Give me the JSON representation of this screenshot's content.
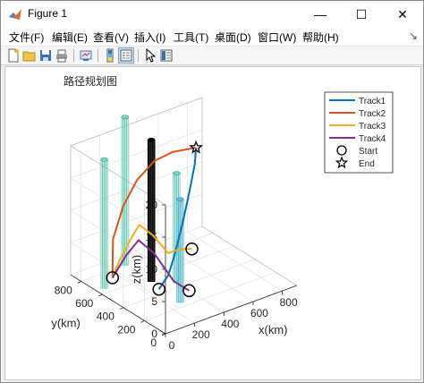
{
  "window": {
    "title": "Figure 1",
    "minimize": "—",
    "maximize": "☐",
    "close": "✕"
  },
  "menu": [
    {
      "label": "文件(F)"
    },
    {
      "label": "编辑(E)"
    },
    {
      "label": "查看(V)"
    },
    {
      "label": "插入(I)"
    },
    {
      "label": "工具(T)"
    },
    {
      "label": "桌面(D)"
    },
    {
      "label": "窗口(W)"
    },
    {
      "label": "帮助(H)"
    }
  ],
  "menu_pin": "↘",
  "toolbar_icons": [
    "new-figure-icon",
    "open-file-icon",
    "save-icon",
    "print-icon",
    "link-plot-icon",
    "toggle-colorbar-icon",
    "insert-legend-icon",
    "pointer-icon",
    "property-inspector-icon"
  ],
  "chart_data": {
    "type": "line3d",
    "title": "路径规划图",
    "xlabel": "x(km)",
    "ylabel": "y(km)",
    "zlabel": "z(km)",
    "xlim": [
      0,
      900
    ],
    "ylim": [
      0,
      900
    ],
    "zlim": [
      0,
      20
    ],
    "xticks": [
      "0",
      "200",
      "400",
      "600",
      "800"
    ],
    "yticks": [
      "0",
      "200",
      "400",
      "600",
      "800"
    ],
    "zticks": [
      "0",
      "5",
      "10",
      "15",
      "20"
    ],
    "grid": true,
    "legend_position": "top-right",
    "legend": [
      {
        "label": "Track1",
        "kind": "line",
        "color": "#0072BD"
      },
      {
        "label": "Track2",
        "kind": "line",
        "color": "#D95319"
      },
      {
        "label": "Track3",
        "kind": "line",
        "color": "#EDB120"
      },
      {
        "label": "Track4",
        "kind": "line",
        "color": "#7E2F8E"
      },
      {
        "label": "Start",
        "kind": "circle",
        "color": "#000000"
      },
      {
        "label": "End",
        "kind": "star",
        "color": "#000000"
      }
    ],
    "obstacles": [
      {
        "x": 50,
        "y": 650,
        "height": 20,
        "color": "#79dbba"
      },
      {
        "x": 300,
        "y": 800,
        "height": 23,
        "color": "#79dbba"
      },
      {
        "x": 300,
        "y": 550,
        "height": 22,
        "color": "#000000"
      },
      {
        "x": 400,
        "y": 450,
        "height": 17,
        "color": "#70d4c6"
      },
      {
        "x": 280,
        "y": 250,
        "height": 16,
        "color": "#55bce8"
      }
    ],
    "start_points": [
      [
        70,
        600,
        2
      ],
      [
        280,
        450,
        0
      ],
      [
        400,
        330,
        0
      ],
      [
        700,
        720,
        0
      ]
    ],
    "end_point": [
      750,
      750,
      15
    ],
    "series": [
      {
        "name": "Track1",
        "color": "#0072BD",
        "points": [
          [
            280,
            450,
            0
          ],
          [
            330,
            430,
            2
          ],
          [
            400,
            470,
            4
          ],
          [
            520,
            560,
            7
          ],
          [
            640,
            660,
            10
          ],
          [
            720,
            720,
            13
          ],
          [
            750,
            750,
            15
          ]
        ]
      },
      {
        "name": "Track2",
        "color": "#D95319",
        "points": [
          [
            70,
            600,
            2
          ],
          [
            160,
            720,
            6
          ],
          [
            260,
            760,
            10
          ],
          [
            360,
            770,
            13
          ],
          [
            480,
            770,
            15
          ],
          [
            600,
            760,
            15.5
          ],
          [
            750,
            750,
            15
          ]
        ]
      },
      {
        "name": "Track3",
        "color": "#EDB120",
        "points": [
          [
            700,
            720,
            0
          ],
          [
            600,
            700,
            1
          ],
          [
            480,
            640,
            2
          ],
          [
            360,
            620,
            6
          ],
          [
            240,
            580,
            9
          ],
          [
            160,
            520,
            9
          ],
          [
            90,
            560,
            5
          ],
          [
            70,
            600,
            2
          ]
        ]
      },
      {
        "name": "Track4",
        "color": "#7E2F8E",
        "points": [
          [
            400,
            330,
            0
          ],
          [
            310,
            350,
            2
          ],
          [
            240,
            440,
            6
          ],
          [
            220,
            560,
            7
          ],
          [
            190,
            640,
            4
          ],
          [
            70,
            600,
            2
          ]
        ]
      }
    ]
  }
}
